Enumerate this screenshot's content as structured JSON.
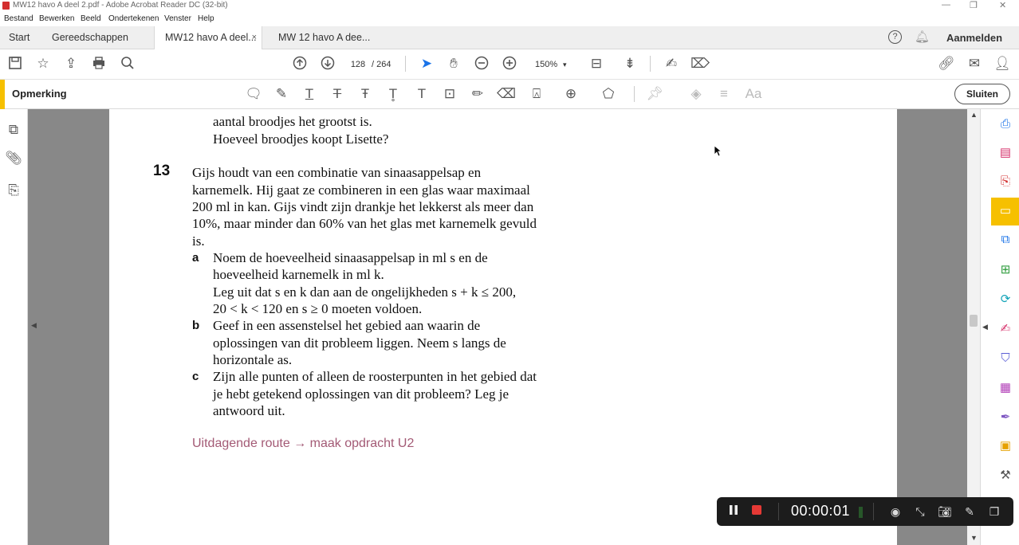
{
  "window": {
    "title": "MW12 havo A deel 2.pdf - Adobe Acrobat Reader DC (32-bit)",
    "minimize": "—",
    "maximize": "❐",
    "close": "✕"
  },
  "menu": [
    "Bestand",
    "Bewerken",
    "Beeld",
    "Ondertekenen",
    "Venster",
    "Help"
  ],
  "tabs": {
    "start": "Start",
    "tools": "Gereedschappen",
    "doc1": "MW12 havo A deel...",
    "doc1_close": "×",
    "doc2": "MW 12 havo A dee...",
    "help_icon": "?",
    "signin": "Aanmelden"
  },
  "toolbar": {
    "page_current": "128",
    "page_sep": "/  264",
    "zoom": "150%",
    "zoom_arrow": "▾"
  },
  "comment_bar": {
    "label": "Opmerking",
    "close_label": "Sluiten"
  },
  "document": {
    "prev_lines": [
      "aantal broodjes het grootst is.",
      "Hoeveel broodjes koopt Lisette?"
    ],
    "question_number": "13",
    "intro": [
      "Gijs houdt van een combinatie van sinaasappelsap en",
      "karnemelk. Hij gaat ze combineren in een glas waar maximaal",
      "200 ml in kan. Gijs vindt zijn drankje het lekkerst als meer dan",
      "10%, maar minder dan 60% van het glas met karnemelk gevuld",
      "is."
    ],
    "a_label": "a",
    "a_lines": [
      "Noem de hoeveelheid sinaasappelsap in ml s en de",
      "hoeveelheid karnemelk in ml k.",
      "Leg uit dat s en k dan aan de ongelijkheden s + k ≤ 200,",
      "20 < k < 120 en s ≥ 0 moeten voldoen."
    ],
    "b_label": "b",
    "b_lines": [
      "Geef in een assenstelsel het gebied aan waarin de",
      "oplossingen van dit probleem liggen. Neem s langs de",
      "horizontale as."
    ],
    "c_label": "c",
    "c_lines": [
      "Zijn alle punten of alleen de roosterpunten in het gebied dat",
      "je hebt getekend oplossingen van dit probleem? Leg je",
      "antwoord uit."
    ],
    "route": "Uitdagende route → maak opdracht U2"
  },
  "recorder": {
    "timer": "00:00:01"
  },
  "icons": {
    "save": "save-icon",
    "star": "star-icon",
    "upload": "upload-icon",
    "print": "print-icon",
    "search": "search-icon"
  },
  "colors": {
    "accent": "#f6c000",
    "route": "#a35a75",
    "acrobat_red": "#d32f2f"
  }
}
